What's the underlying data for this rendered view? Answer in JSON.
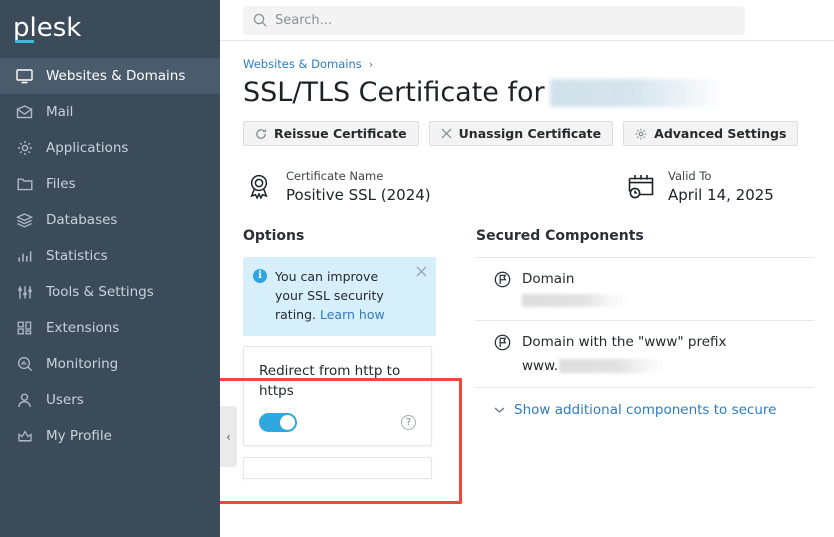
{
  "brand": {
    "logo_text": "plesk",
    "accent_color": "#3bbdd8"
  },
  "sidebar": {
    "items": [
      {
        "label": "Websites & Domains",
        "icon": "monitor-icon",
        "active": true
      },
      {
        "label": "Mail",
        "icon": "envelope-icon",
        "active": false
      },
      {
        "label": "Applications",
        "icon": "gear-icon",
        "active": false
      },
      {
        "label": "Files",
        "icon": "folder-icon",
        "active": false
      },
      {
        "label": "Databases",
        "icon": "database-icon",
        "active": false
      },
      {
        "label": "Statistics",
        "icon": "bar-chart-icon",
        "active": false
      },
      {
        "label": "Tools & Settings",
        "icon": "sliders-icon",
        "active": false
      },
      {
        "label": "Extensions",
        "icon": "blocks-icon",
        "active": false
      },
      {
        "label": "Monitoring",
        "icon": "magnifier-chart-icon",
        "active": false
      },
      {
        "label": "Users",
        "icon": "user-icon",
        "active": false
      },
      {
        "label": "My Profile",
        "icon": "crown-icon",
        "active": false
      }
    ]
  },
  "topbar": {
    "search": {
      "placeholder": "Search...",
      "value": "",
      "icon": "search-icon"
    }
  },
  "breadcrumb": {
    "parent": "Websites & Domains",
    "separator": "›"
  },
  "page": {
    "title": "SSL/TLS Certificate for",
    "domain_redacted": true
  },
  "actions": [
    {
      "label": "Reissue Certificate",
      "icon": "refresh-icon"
    },
    {
      "label": "Unassign Certificate",
      "icon": "close-icon"
    },
    {
      "label": "Advanced Settings",
      "icon": "gear-icon"
    }
  ],
  "cert_info": [
    {
      "label": "Certificate Name",
      "value": "Positive SSL (2024)",
      "icon": "certificate-seal-icon"
    },
    {
      "label": "Valid To",
      "value": "April 14, 2025",
      "icon": "calendar-clock-icon"
    }
  ],
  "options": {
    "title": "Options",
    "alert": {
      "icon": "info-icon",
      "text": "You can improve your SSL security rating. ",
      "link_text": "Learn how",
      "close_icon": "close-icon"
    },
    "redirect_card": {
      "title": "Redirect from http to https",
      "toggle_on": true,
      "toggle_color": "#2fa8e0",
      "help_icon": "question-mark-icon",
      "help_glyph": "?"
    }
  },
  "secured_components": {
    "title": "Secured Components",
    "rows": [
      {
        "name": "Domain",
        "value_redacted": true,
        "value_prefix": "",
        "icon": "flag-circle-icon"
      },
      {
        "name": "Domain with the \"www\" prefix",
        "value_redacted": true,
        "value_prefix": "www.",
        "icon": "flag-circle-icon"
      }
    ],
    "show_more_label": "Show additional components to secure",
    "show_more_icon": "chevron-down-icon"
  },
  "collapse_handle": {
    "icon": "chevron-left-icon",
    "glyph": "‹"
  },
  "highlight": {
    "color": "#f4463c"
  }
}
